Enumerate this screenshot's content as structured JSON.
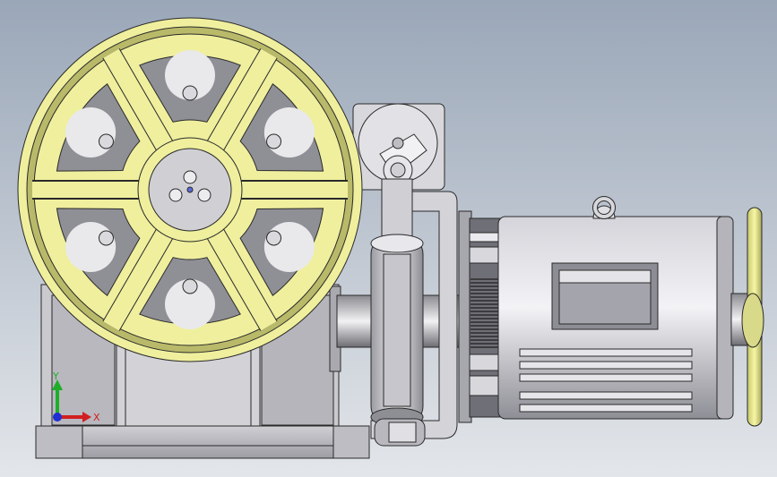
{
  "viewport": {
    "background_top": "#9aa7b8",
    "background_bottom": "#dfe3e8"
  },
  "colors": {
    "sheave": "#efef9e",
    "sheave_dark": "#b9b96a",
    "outline": "#2a2a2a",
    "metal_light": "#e8e8ea",
    "metal_mid": "#bcbcc2",
    "metal_dark": "#7b7b82",
    "axis_x": "#d21f1f",
    "axis_y": "#1fae2a",
    "axis_z": "#1f2fd2"
  },
  "triad": {
    "x_label": "X",
    "y_label": "Y",
    "x_icon": "x-axis-arrow-icon",
    "y_icon": "y-axis-arrow-icon",
    "z_icon": "z-axis-dot-icon"
  }
}
